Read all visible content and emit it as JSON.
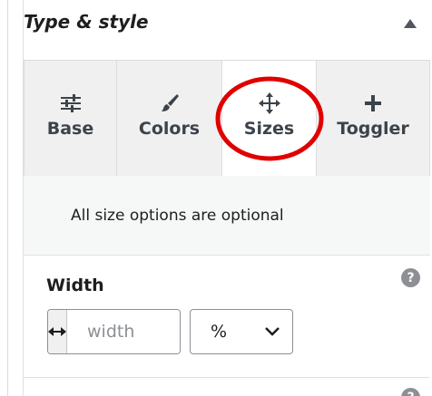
{
  "section": {
    "title": "Type & style",
    "collapse_icon": "triangle-up-icon"
  },
  "tabs": [
    {
      "label": "Base",
      "icon": "sliders-icon",
      "active": false
    },
    {
      "label": "Colors",
      "icon": "paintbrush-icon",
      "active": false
    },
    {
      "label": "Sizes",
      "icon": "move-arrows-icon",
      "active": true
    },
    {
      "label": "Toggler",
      "icon": "plus-icon",
      "active": false
    }
  ],
  "info": {
    "text": "All size options are optional"
  },
  "width_field": {
    "label": "Width",
    "placeholder": "width",
    "value": "",
    "addon_icon": "horizontal-arrows-icon",
    "help_icon": "help-icon"
  },
  "unit_select": {
    "value": "%",
    "icon": "chevron-down-icon"
  },
  "annotation": {
    "color": "#e00000",
    "target": "Sizes"
  },
  "colors": {
    "tab_background": "#f0f0f1",
    "active_tab_background": "#ffffff",
    "border": "#dcdcde",
    "text": "#1e1e1e"
  }
}
